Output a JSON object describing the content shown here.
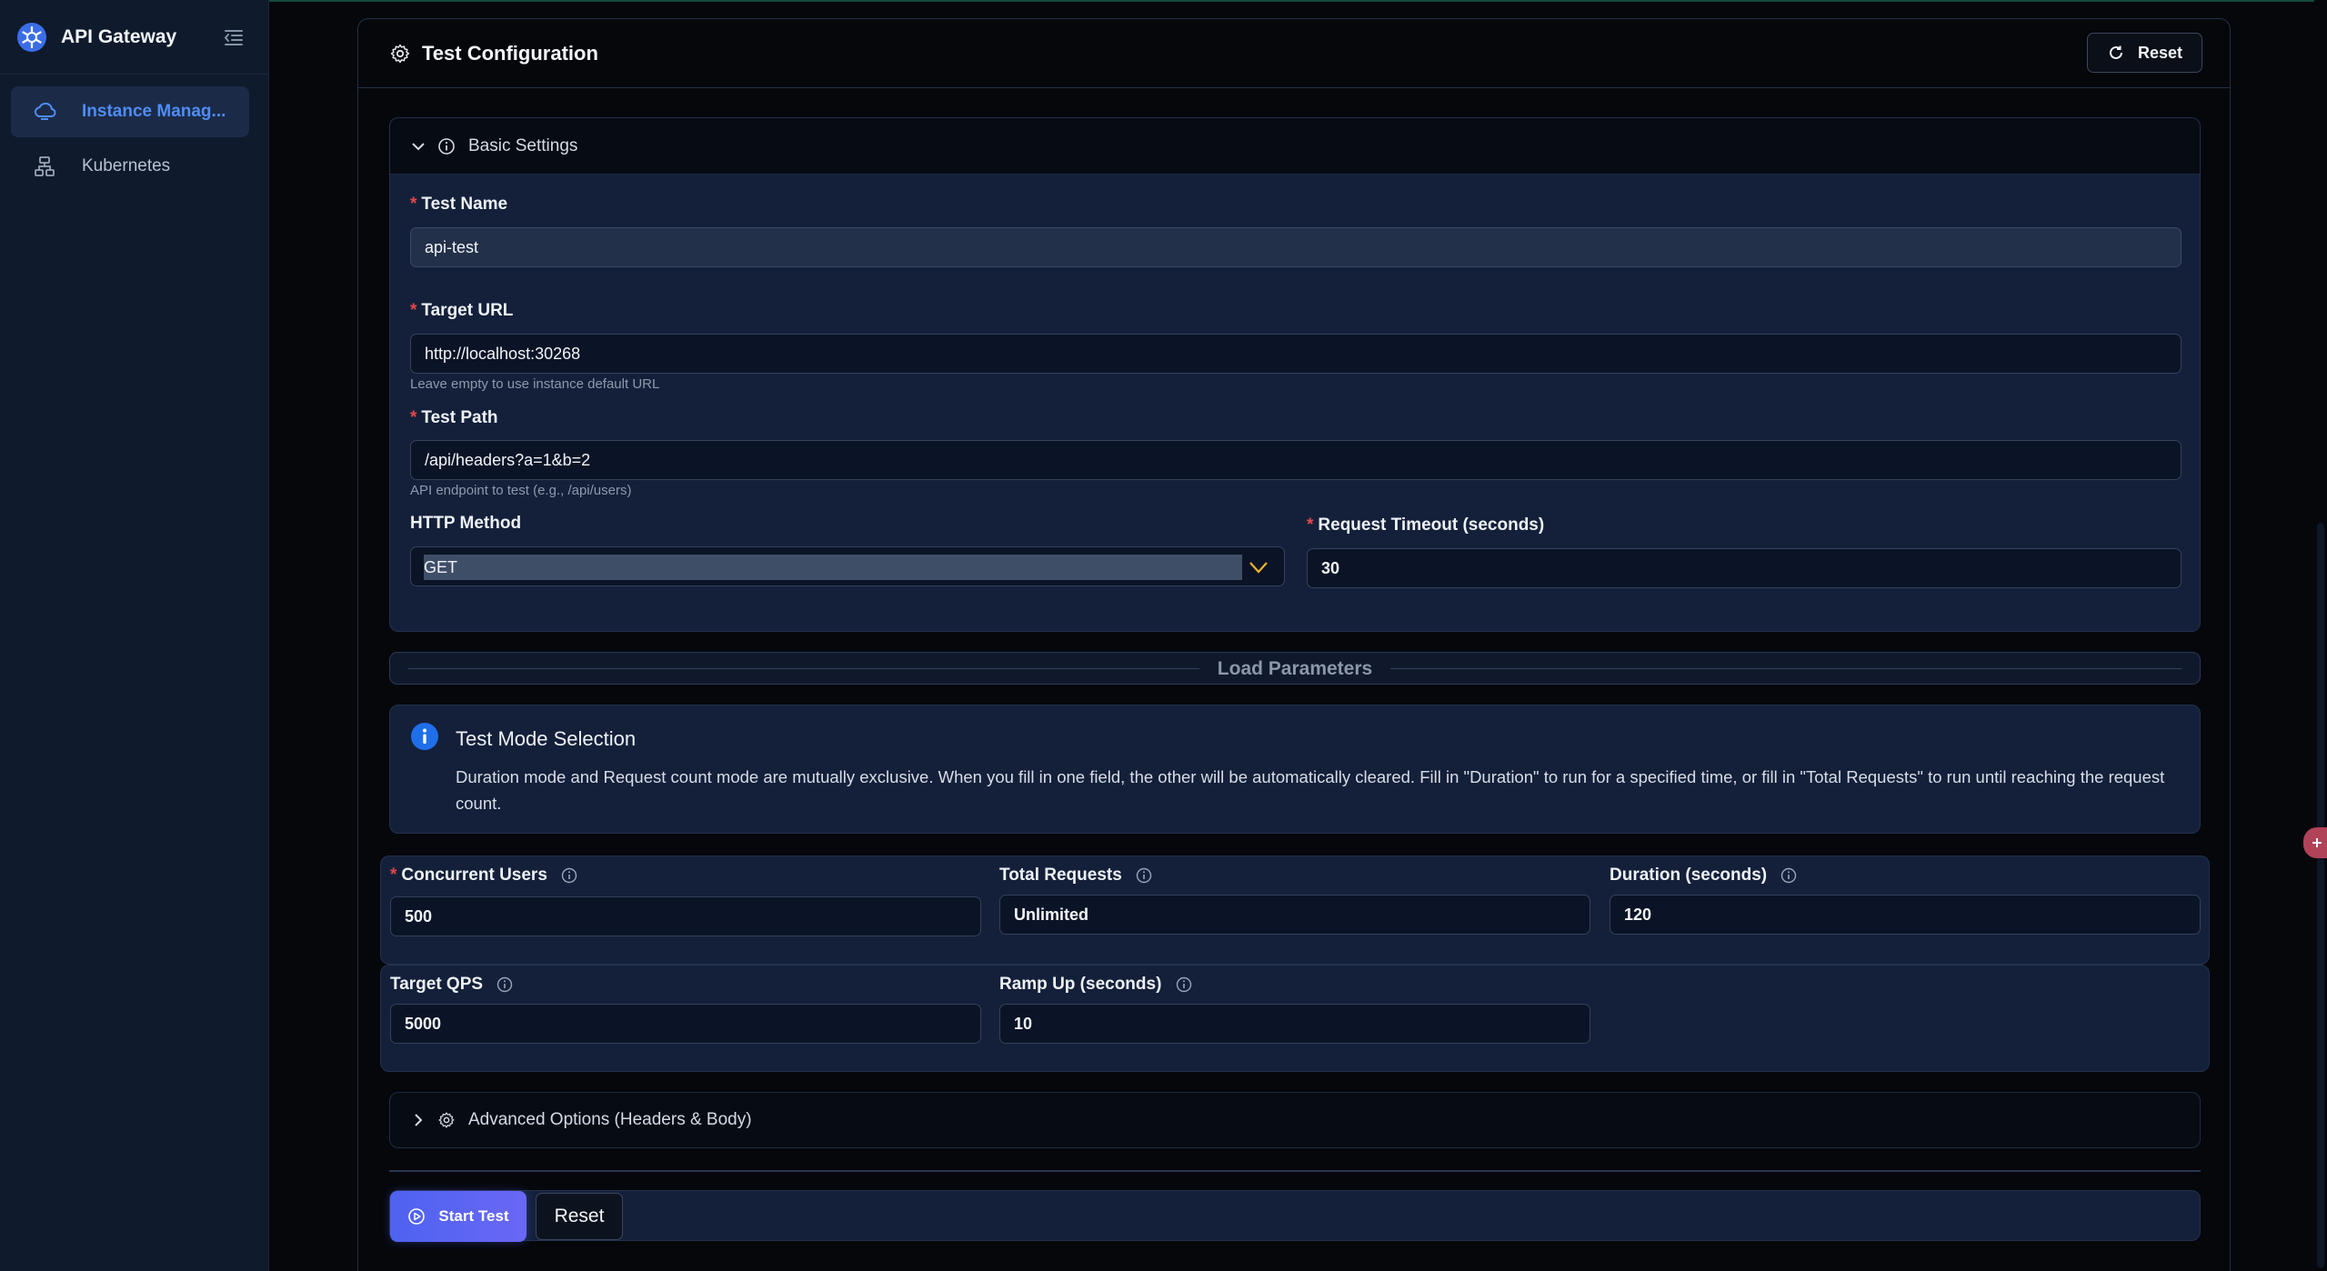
{
  "app": {
    "title": "API Gateway"
  },
  "sidebar": {
    "items": [
      {
        "label": "Instance Manag...",
        "icon": "cloud-icon",
        "active": true
      },
      {
        "label": "Kubernetes",
        "icon": "cluster-icon",
        "active": false
      }
    ]
  },
  "card": {
    "title": "Test Configuration",
    "reset_label": "Reset"
  },
  "basic": {
    "title": "Basic Settings",
    "test_name": {
      "label": "Test Name",
      "value": "api-test"
    },
    "target_url": {
      "label": "Target URL",
      "value": "http://localhost:30268",
      "hint": "Leave empty to use instance default URL"
    },
    "test_path": {
      "label": "Test Path",
      "value": "/api/headers?a=1&b=2",
      "hint": "API endpoint to test (e.g., /api/users)"
    },
    "http_method": {
      "label": "HTTP Method",
      "value": "GET"
    },
    "timeout": {
      "label": "Request Timeout (seconds)",
      "value": "30"
    }
  },
  "load": {
    "section_title": "Load Parameters",
    "alert_title": "Test Mode Selection",
    "alert_body": "Duration mode and Request count mode are mutually exclusive. When you fill in one field, the other will be automatically cleared. Fill in \"Duration\" to run for a specified time, or fill in \"Total Requests\" to run until reaching the request count.",
    "concurrent_users": {
      "label": "Concurrent Users",
      "value": "500"
    },
    "total_requests": {
      "label": "Total Requests",
      "value": "Unlimited"
    },
    "duration": {
      "label": "Duration (seconds)",
      "value": "120"
    },
    "target_qps": {
      "label": "Target QPS",
      "value": "5000"
    },
    "ramp_up": {
      "label": "Ramp Up (seconds)",
      "value": "10"
    }
  },
  "advanced": {
    "title": "Advanced Options (Headers & Body)"
  },
  "actions": {
    "start_label": "Start Test",
    "reset_label": "Reset"
  },
  "colors": {
    "accent": "#4f8df5",
    "primary_button": "#5a64f2",
    "required": "#e5484d",
    "info": "#1f6feb"
  }
}
